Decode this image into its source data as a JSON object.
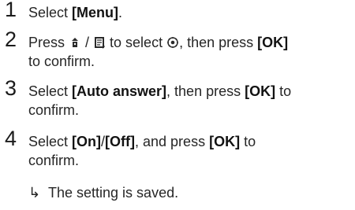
{
  "top_fragment": "",
  "steps": [
    {
      "number": "1",
      "parts": [
        {
          "text": "Select ",
          "bold": false
        },
        {
          "text": "[Menu]",
          "bold": true
        },
        {
          "text": ".",
          "bold": false
        }
      ]
    },
    {
      "number": "2",
      "parts_line1": [
        {
          "text": "Press ",
          "bold": false
        },
        {
          "icon": "phonebook-up-icon"
        },
        {
          "text": " / ",
          "bold": false
        },
        {
          "icon": "phonebook-down-icon"
        },
        {
          "text": " to select ",
          "bold": false
        },
        {
          "icon": "settings-gear-icon"
        },
        {
          "text": ", then press ",
          "bold": false
        },
        {
          "text": "[OK]",
          "bold": true
        }
      ],
      "parts_line2": [
        {
          "text": "to confirm.",
          "bold": false
        }
      ]
    },
    {
      "number": "3",
      "parts_line1": [
        {
          "text": "Select ",
          "bold": false
        },
        {
          "text": "[Auto answer]",
          "bold": true
        },
        {
          "text": ", then press ",
          "bold": false
        },
        {
          "text": "[OK]",
          "bold": true
        },
        {
          "text": " to",
          "bold": false
        }
      ],
      "parts_line2": [
        {
          "text": "confirm.",
          "bold": false
        }
      ]
    },
    {
      "number": "4",
      "parts_line1": [
        {
          "text": "Select ",
          "bold": false
        },
        {
          "text": "[On]",
          "bold": true
        },
        {
          "text": "/",
          "bold": false
        },
        {
          "text": "[Off]",
          "bold": true
        },
        {
          "text": ", and press ",
          "bold": false
        },
        {
          "text": "[OK]",
          "bold": true
        },
        {
          "text": " to",
          "bold": false
        }
      ],
      "parts_line2": [
        {
          "text": "confirm.",
          "bold": false
        }
      ]
    }
  ],
  "result": {
    "arrow": "↳",
    "text": "The setting is saved."
  }
}
